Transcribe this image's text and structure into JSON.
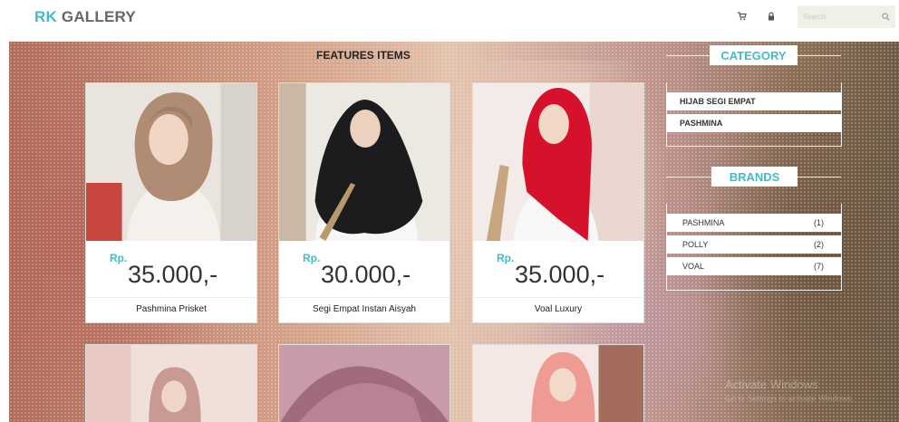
{
  "brand": {
    "part1": "RK",
    "part2": "GALLERY"
  },
  "header": {
    "cart_icon": "cart-icon",
    "lock_icon": "lock-icon",
    "search_placeholder": "Search",
    "search_icon": "search-icon"
  },
  "main": {
    "title": "FEATURES ITEMS"
  },
  "products": [
    {
      "currency": "Rp.",
      "price": "35.000,-",
      "name": "Pashmina Prisket"
    },
    {
      "currency": "Rp.",
      "price": "30.000,-",
      "name": "Segi Empat Instan Aisyah"
    },
    {
      "currency": "Rp.",
      "price": "35.000,-",
      "name": "Voal Luxury"
    }
  ],
  "category": {
    "title": "CATEGORY",
    "items": [
      "HIJAB SEGI EMPAT",
      "PASHMINA"
    ]
  },
  "brands": {
    "title": "BRANDS",
    "items": [
      {
        "label": "PASHMINA",
        "count": "(1)"
      },
      {
        "label": "POLLY",
        "count": "(2)"
      },
      {
        "label": "VOAL",
        "count": "(7)"
      }
    ]
  },
  "watermark": {
    "line1": "Activate Windows",
    "line2": "Go to Settings to activate Windows."
  },
  "colors": {
    "accent": "#3dbfc4",
    "text": "#333333"
  }
}
